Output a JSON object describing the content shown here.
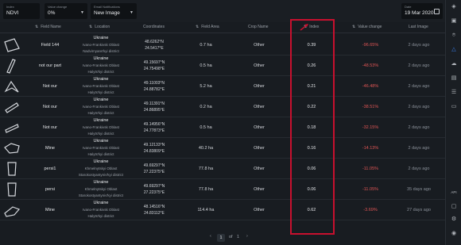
{
  "toolbar": {
    "index": {
      "label": "Index",
      "value": "NDVI"
    },
    "value_change": {
      "label": "Value change",
      "value": "0%"
    },
    "email": {
      "label": "Email Notifications",
      "value": "New Image"
    },
    "date": {
      "label": "Date",
      "value": "19 Mar 2020"
    }
  },
  "columns": {
    "field_name": "Field Name",
    "location": "Location",
    "coordinates": "Coordinates",
    "field_area": "Field Area",
    "crop_name": "Crop Name",
    "index": "Index",
    "value_change": "Value change",
    "last_image": "Last Image"
  },
  "rows": [
    {
      "name": "Field 144",
      "country": "Ukraine",
      "region1": "Ivano-Frankivsk Oblast",
      "region2": "Nadvirnyans'kyi district",
      "lat": "48.6262°N",
      "lon": "24.5417°E",
      "area": "0.7 ha",
      "crop": "Other",
      "index": "0.39",
      "change": "-96.65%",
      "last": "2 days ago"
    },
    {
      "name": "not our part",
      "country": "Ukraine",
      "region1": "Ivano-Frankivsk Oblast",
      "region2": "Halyts'kyi district",
      "lat": "49.15697°N",
      "lon": "24.75498°E",
      "area": "0.5 ha",
      "crop": "Other",
      "index": "0.26",
      "change": "-48.53%",
      "last": "2 days ago"
    },
    {
      "name": "Not our",
      "country": "Ukraine",
      "region1": "Ivano-Frankivsk Oblast",
      "region2": "Halyts'kyi district",
      "lat": "49.11003°N",
      "lon": "24.88782°E",
      "area": "5.2 ha",
      "crop": "Other",
      "index": "0.21",
      "change": "-46.48%",
      "last": "2 days ago"
    },
    {
      "name": "Not our",
      "country": "Ukraine",
      "region1": "Ivano-Frankivsk Oblast",
      "region2": "Halyts'kyi district",
      "lat": "49.11391°N",
      "lon": "24.86895°E",
      "area": "0.2 ha",
      "crop": "Other",
      "index": "0.22",
      "change": "-38.51%",
      "last": "2 days ago"
    },
    {
      "name": "Not our",
      "country": "Ukraine",
      "region1": "Ivano-Frankivsk Oblast",
      "region2": "Halyts'kyi district",
      "lat": "49.14956°N",
      "lon": "24.77873°E",
      "area": "0.5 ha",
      "crop": "Other",
      "index": "0.18",
      "change": "-32.15%",
      "last": "2 days ago"
    },
    {
      "name": "Mine",
      "country": "Ukraine",
      "region1": "Ivano-Frankivsk Oblast",
      "region2": "Halyts'kyi district",
      "lat": "49.12133°N",
      "lon": "24.83809°E",
      "area": "40.2 ha",
      "crop": "Other",
      "index": "0.16",
      "change": "-14.13%",
      "last": "2 days ago"
    },
    {
      "name": "persi1",
      "country": "Ukraine",
      "region1": "Khmelnytskyi Oblast",
      "region2": "Starokostyantyniv'kyi district",
      "lat": "49.69297°N",
      "lon": "27.22375°E",
      "area": "77.8 ha",
      "crop": "Other",
      "index": "0.06",
      "change": "-11.05%",
      "last": "2 days ago"
    },
    {
      "name": "persi",
      "country": "Ukraine",
      "region1": "Khmelnytskyi Oblast",
      "region2": "Starokostyantyniv'kyi district",
      "lat": "49.69297°N",
      "lon": "27.22375°E",
      "area": "77.8 ha",
      "crop": "Other",
      "index": "0.06",
      "change": "-11.05%",
      "last": "35 days ago"
    },
    {
      "name": "Mine",
      "country": "Ukraine",
      "region1": "Ivano-Frankivsk Oblast",
      "region2": "Halyts'kyi district",
      "lat": "48.14516°N",
      "lon": "24.83112°E",
      "area": "114.4 ha",
      "crop": "Other",
      "index": "0.62",
      "change": "-3.69%",
      "last": "27 days ago"
    }
  ],
  "pagination": {
    "prev": "‹",
    "page": "1",
    "of": "of",
    "total": "1",
    "next": "›"
  },
  "colors": {
    "highlight": "#c8102e",
    "negative": "#e05555",
    "accent": "#3b82f6"
  },
  "rail_icons": [
    "layers-icon",
    "map-icon",
    "pin-icon",
    "upload-icon",
    "cloud-icon",
    "chart-icon",
    "list-icon",
    "folder-icon",
    "settings-icon",
    "user-icon"
  ],
  "rail_label": "API"
}
